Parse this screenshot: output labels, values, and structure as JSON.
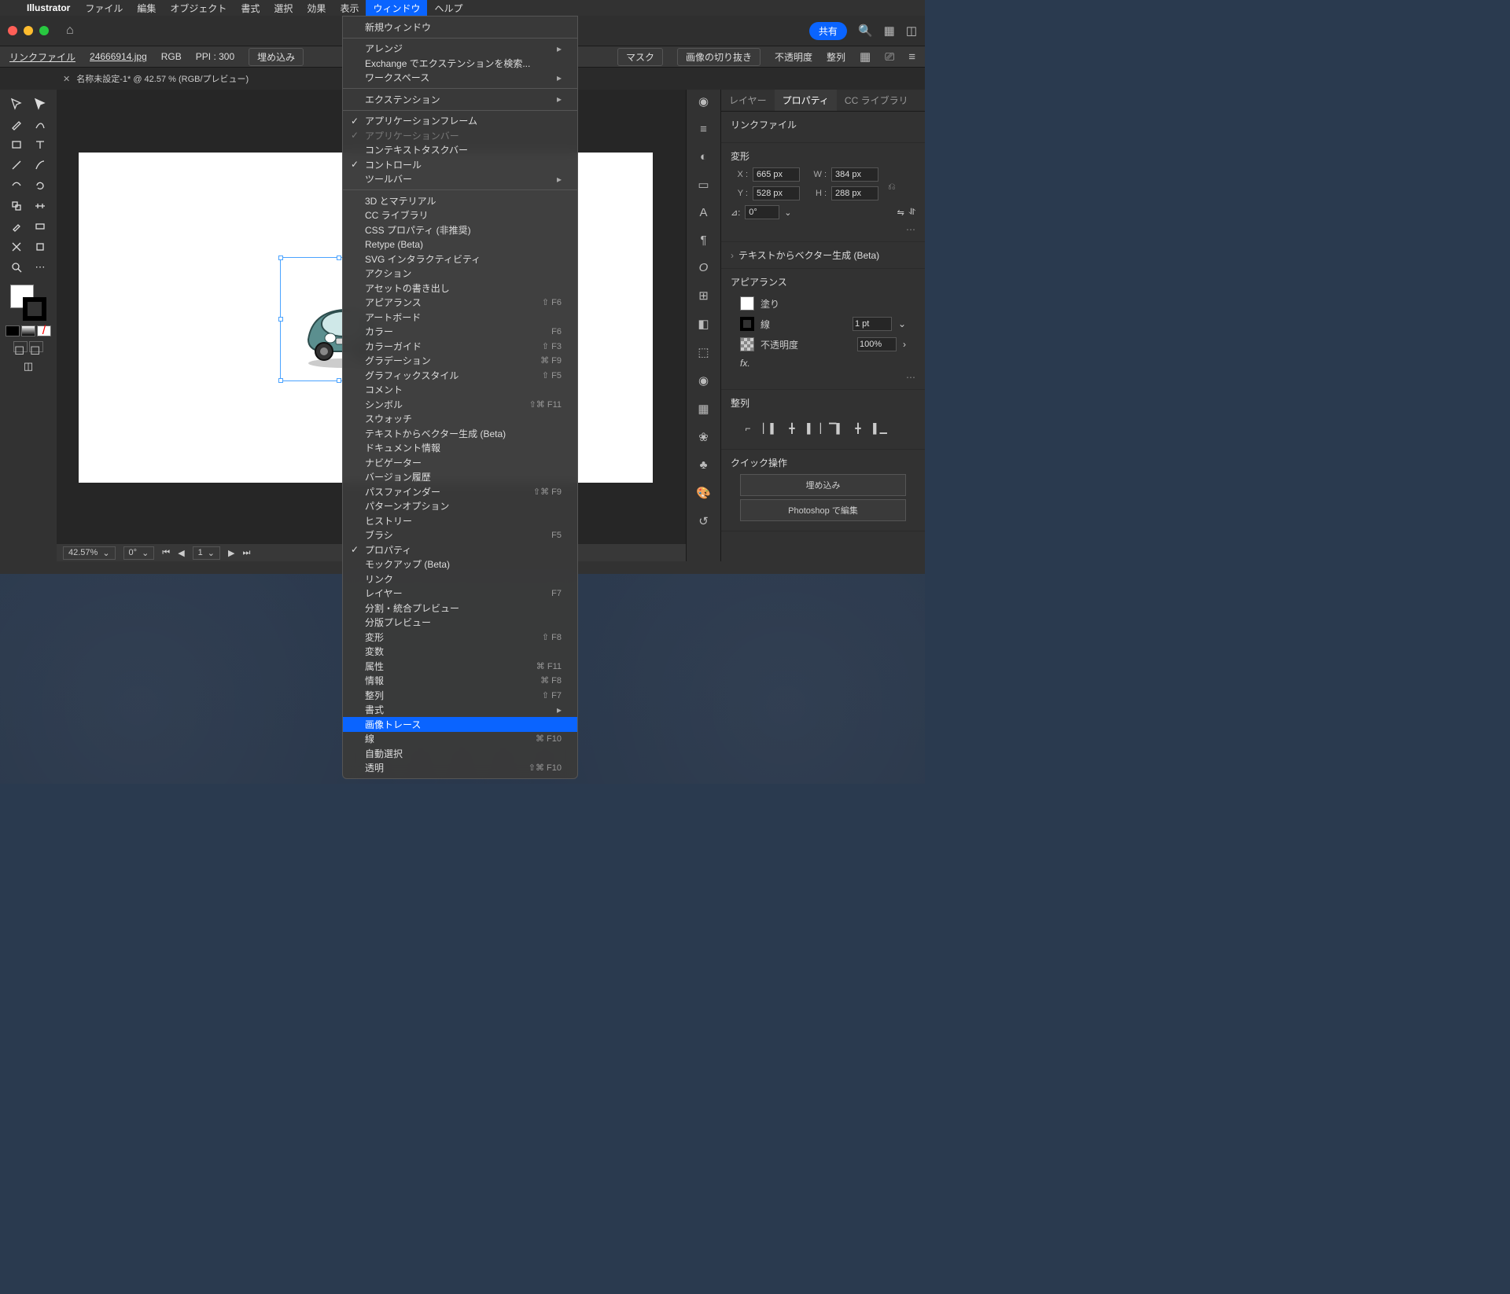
{
  "menubar": {
    "app": "Illustrator",
    "items": [
      "ファイル",
      "編集",
      "オブジェクト",
      "書式",
      "選択",
      "効果",
      "表示",
      "ウィンドウ",
      "ヘルプ"
    ],
    "active_index": 7
  },
  "titlebar": {
    "share": "共有"
  },
  "controlbar": {
    "link_label": "リンクファイル",
    "filename": "24666914.jpg",
    "color_mode": "RGB",
    "ppi": "PPI : 300",
    "embed": "埋め込み",
    "mask": "マスク",
    "crop": "画像の切り抜き",
    "opacity": "不透明度",
    "align": "整列"
  },
  "tab": {
    "name": "名称未設定-1* @ 42.57 % (RGB/プレビュー)"
  },
  "status": {
    "zoom": "42.57%",
    "rotate": "0°",
    "page": "1"
  },
  "panels": {
    "tabs": [
      "レイヤー",
      "プロパティ",
      "CC ライブラリ"
    ],
    "active_tab": 1,
    "title": "リンクファイル",
    "transform_label": "変形",
    "x_label": "X :",
    "x_val": "665 px",
    "y_label": "Y :",
    "y_val": "528 px",
    "w_label": "W :",
    "w_val": "384 px",
    "h_label": "H :",
    "h_val": "288 px",
    "angle_val": "0°",
    "text2vec": "テキストからベクター生成 (Beta)",
    "appearance_label": "アピアランス",
    "fill_label": "塗り",
    "stroke_label": "線",
    "stroke_val": "1 pt",
    "opacity_label": "不透明度",
    "opacity_val": "100%",
    "fx_label": "fx.",
    "align_label": "整列",
    "quick_label": "クイック操作",
    "embed_btn": "埋め込み",
    "ps_btn": "Photoshop で編集"
  },
  "menu": {
    "groups": [
      [
        {
          "label": "新規ウィンドウ"
        }
      ],
      [
        {
          "label": "アレンジ",
          "arrow": true
        },
        {
          "label": "Exchange でエクステンションを検索..."
        },
        {
          "label": "ワークスペース",
          "arrow": true
        }
      ],
      [
        {
          "label": "エクステンション",
          "arrow": true
        }
      ],
      [
        {
          "label": "アプリケーションフレーム",
          "check": true
        },
        {
          "label": "アプリケーションバー",
          "check": true,
          "disabled": true
        },
        {
          "label": "コンテキストタスクバー"
        },
        {
          "label": "コントロール",
          "check": true
        },
        {
          "label": "ツールバー",
          "arrow": true
        }
      ],
      [
        {
          "label": "3D とマテリアル"
        },
        {
          "label": "CC ライブラリ"
        },
        {
          "label": "CSS プロパティ (非推奨)"
        },
        {
          "label": "Retype (Beta)"
        },
        {
          "label": "SVG インタラクティビティ"
        },
        {
          "label": "アクション"
        },
        {
          "label": "アセットの書き出し"
        },
        {
          "label": "アピアランス",
          "shortcut": "⇧ F6"
        },
        {
          "label": "アートボード"
        },
        {
          "label": "カラー",
          "shortcut": "F6"
        },
        {
          "label": "カラーガイド",
          "shortcut": "⇧ F3"
        },
        {
          "label": "グラデーション",
          "shortcut": "⌘ F9"
        },
        {
          "label": "グラフィックスタイル",
          "shortcut": "⇧ F5"
        },
        {
          "label": "コメント"
        },
        {
          "label": "シンボル",
          "shortcut": "⇧⌘ F11"
        },
        {
          "label": "スウォッチ"
        },
        {
          "label": "テキストからベクター生成 (Beta)"
        },
        {
          "label": "ドキュメント情報"
        },
        {
          "label": "ナビゲーター"
        },
        {
          "label": "バージョン履歴"
        },
        {
          "label": "パスファインダー",
          "shortcut": "⇧⌘ F9"
        },
        {
          "label": "パターンオプション"
        },
        {
          "label": "ヒストリー"
        },
        {
          "label": "ブラシ",
          "shortcut": "F5"
        },
        {
          "label": "プロパティ",
          "check": true
        },
        {
          "label": "モックアップ (Beta)"
        },
        {
          "label": "リンク"
        },
        {
          "label": "レイヤー",
          "shortcut": "F7"
        },
        {
          "label": "分割・統合プレビュー"
        },
        {
          "label": "分版プレビュー"
        },
        {
          "label": "変形",
          "shortcut": "⇧ F8"
        },
        {
          "label": "変数"
        },
        {
          "label": "属性",
          "shortcut": "⌘ F11"
        },
        {
          "label": "情報",
          "shortcut": "⌘ F8"
        },
        {
          "label": "整列",
          "shortcut": "⇧ F7"
        },
        {
          "label": "書式",
          "arrow": true
        },
        {
          "label": "画像トレース",
          "selected": true
        },
        {
          "label": "線",
          "shortcut": "⌘ F10"
        },
        {
          "label": "自動選択"
        },
        {
          "label": "透明",
          "shortcut": "⇧⌘ F10"
        }
      ]
    ]
  }
}
